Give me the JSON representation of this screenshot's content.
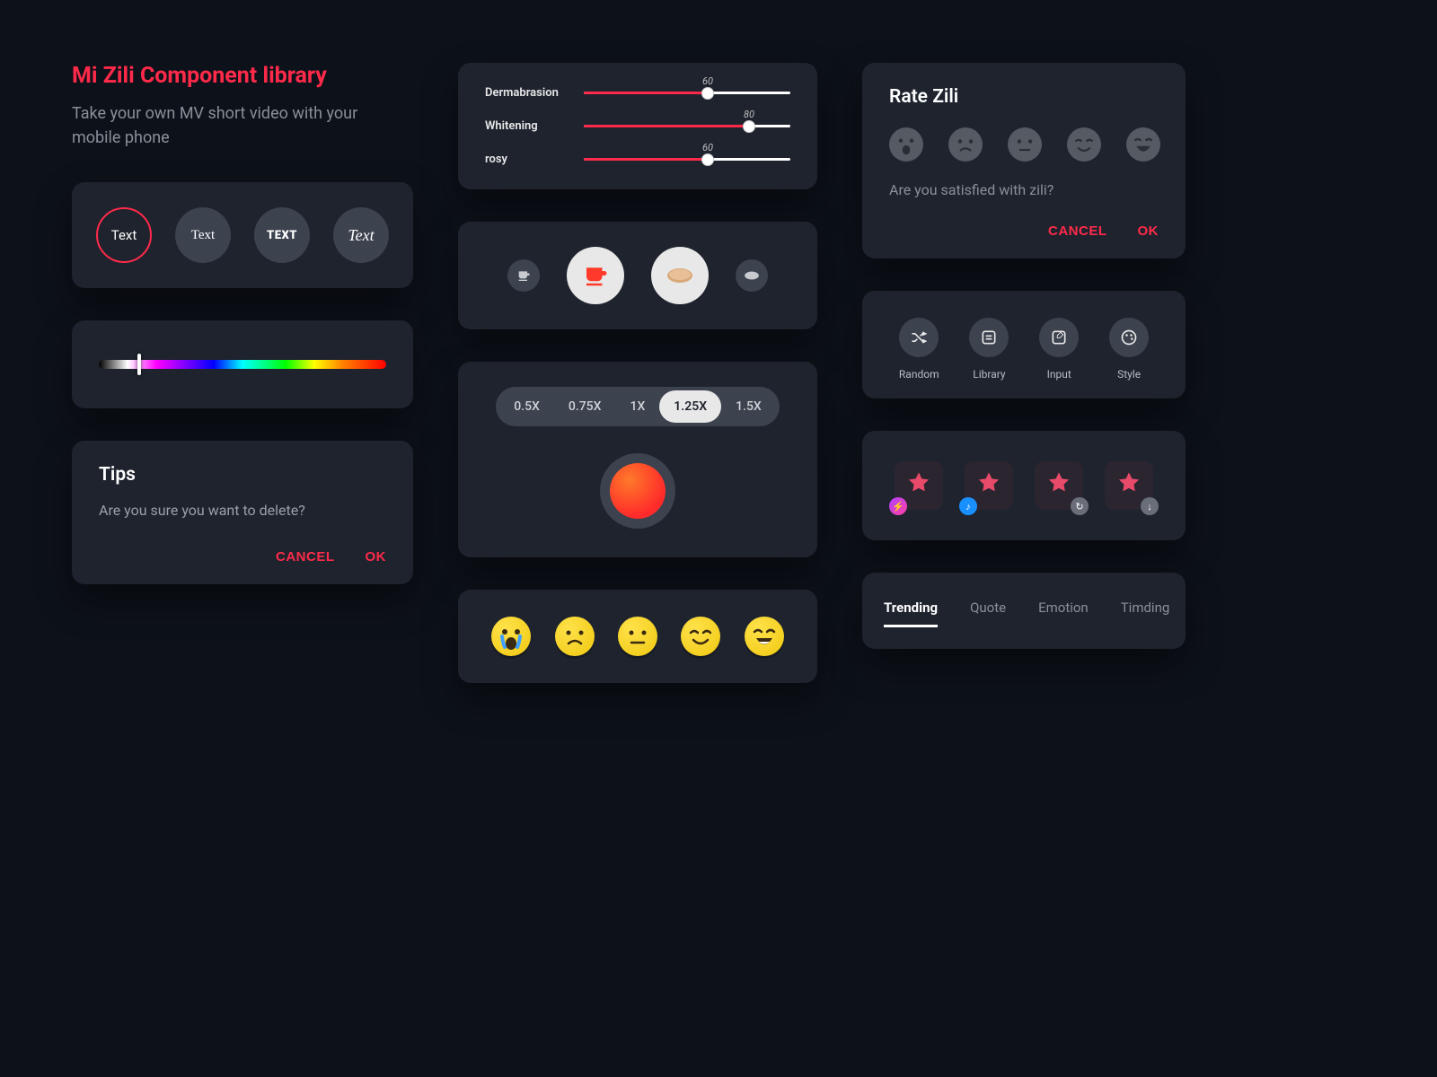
{
  "hero": {
    "title": "Mi Zili Component library",
    "subtitle": "Take your own MV short video with your mobile phone"
  },
  "sliders": [
    {
      "label": "Dermabrasion",
      "value": 60
    },
    {
      "label": "Whitening",
      "value": 80
    },
    {
      "label": "rosy",
      "value": 60
    }
  ],
  "rate": {
    "title": "Rate Zili",
    "question": "Are you satisfied with zili?",
    "cancel": "CANCEL",
    "ok": "OK"
  },
  "textStyles": [
    "Text",
    "Text",
    "TEXT",
    "Text"
  ],
  "actions": [
    {
      "label": "Random"
    },
    {
      "label": "Library"
    },
    {
      "label": "Input"
    },
    {
      "label": "Style"
    }
  ],
  "speed": {
    "options": [
      "0.5X",
      "0.75X",
      "1X",
      "1.25X",
      "1.5X"
    ],
    "active": "1.25X"
  },
  "tips": {
    "title": "Tips",
    "message": "Are you sure you want to delete?",
    "cancel": "CANCEL",
    "ok": "OK"
  },
  "tabs": {
    "items": [
      "Trending",
      "Quote",
      "Emotion",
      "Timding"
    ],
    "active": "Trending"
  },
  "huePosition": 14,
  "colors": {
    "accent": "#ff2a4a"
  }
}
